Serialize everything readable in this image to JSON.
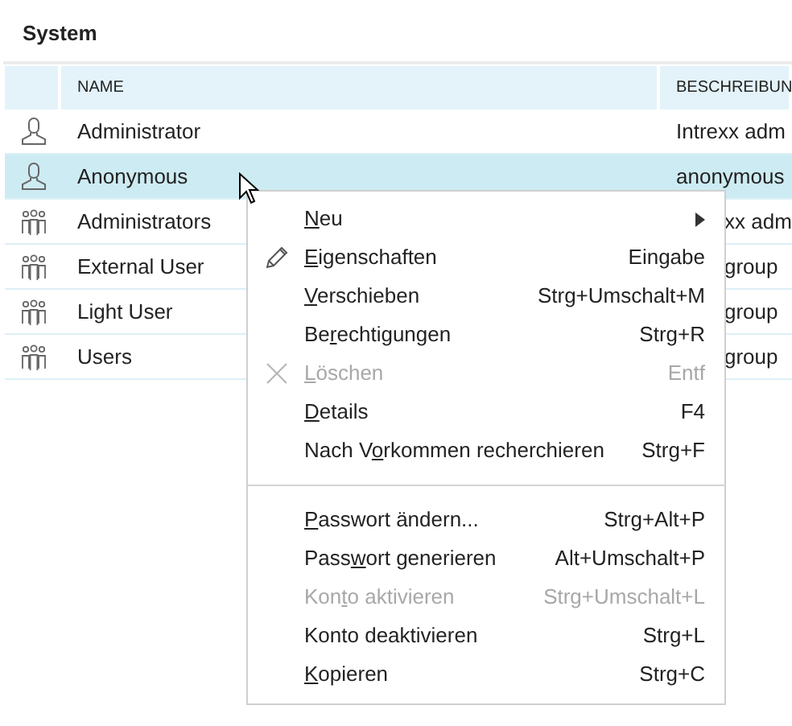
{
  "panel": {
    "title": "System"
  },
  "table": {
    "columns": [
      "NAME",
      "BESCHREIBUN"
    ],
    "rows": [
      {
        "kind": "user",
        "name": "Administrator",
        "description": "Intrexx adm",
        "selected": false,
        "partly_hidden": false
      },
      {
        "kind": "user",
        "name": "Anonymous",
        "description": "anonymous",
        "selected": true,
        "partly_hidden": false
      },
      {
        "kind": "group",
        "name": "Administrators",
        "description": "xx adm",
        "selected": false,
        "partly_hidden": true
      },
      {
        "kind": "group",
        "name": "External User",
        "description": "group",
        "selected": false,
        "partly_hidden": true
      },
      {
        "kind": "group",
        "name": "Light User",
        "description": "group",
        "selected": false,
        "partly_hidden": true
      },
      {
        "kind": "group",
        "name": "Users",
        "description": "group",
        "selected": false,
        "partly_hidden": true
      }
    ]
  },
  "context_menu": {
    "groups": [
      [
        {
          "kind": "submenu",
          "label": {
            "key": "N",
            "post": "eu"
          },
          "disabled": false
        },
        {
          "kind": "edit",
          "label": {
            "key": "E",
            "post": "igenschaften"
          },
          "shortcut": "Eingabe",
          "disabled": false
        },
        {
          "kind": "plain",
          "label": {
            "key": "V",
            "post": "erschieben"
          },
          "shortcut": "Strg+Umschalt+M",
          "disabled": false
        },
        {
          "kind": "plain",
          "label": {
            "pre": "Be",
            "key": "r",
            "post": "echtigungen"
          },
          "shortcut": "Strg+R",
          "disabled": false
        },
        {
          "kind": "delete",
          "label": {
            "key": "L",
            "post": "öschen"
          },
          "shortcut": "Entf",
          "disabled": true
        },
        {
          "kind": "plain",
          "label": {
            "key": "D",
            "post": "etails"
          },
          "shortcut": "F4",
          "disabled": false
        },
        {
          "kind": "plain",
          "label": {
            "pre": "Nach V",
            "key": "o",
            "post": "rkommen recherchieren"
          },
          "shortcut": "Strg+F",
          "disabled": false
        }
      ],
      [
        {
          "kind": "plain",
          "label": {
            "key": "P",
            "post": "asswort ändern..."
          },
          "shortcut": "Strg+Alt+P",
          "disabled": false
        },
        {
          "kind": "plain",
          "label": {
            "pre": "Pass",
            "key": "w",
            "post": "ort generieren"
          },
          "shortcut": "Alt+Umschalt+P",
          "disabled": false
        },
        {
          "kind": "plain",
          "label": {
            "pre": "Kon",
            "key": "t",
            "post": "o aktivieren"
          },
          "shortcut": "Strg+Umschalt+L",
          "disabled": true
        },
        {
          "kind": "plain",
          "label": {
            "pre": "Konto deaktivieren"
          },
          "shortcut": "Strg+L",
          "disabled": false
        },
        {
          "kind": "plain",
          "label": {
            "key": "K",
            "post": "opieren"
          },
          "shortcut": "Strg+C",
          "disabled": false
        }
      ]
    ]
  }
}
